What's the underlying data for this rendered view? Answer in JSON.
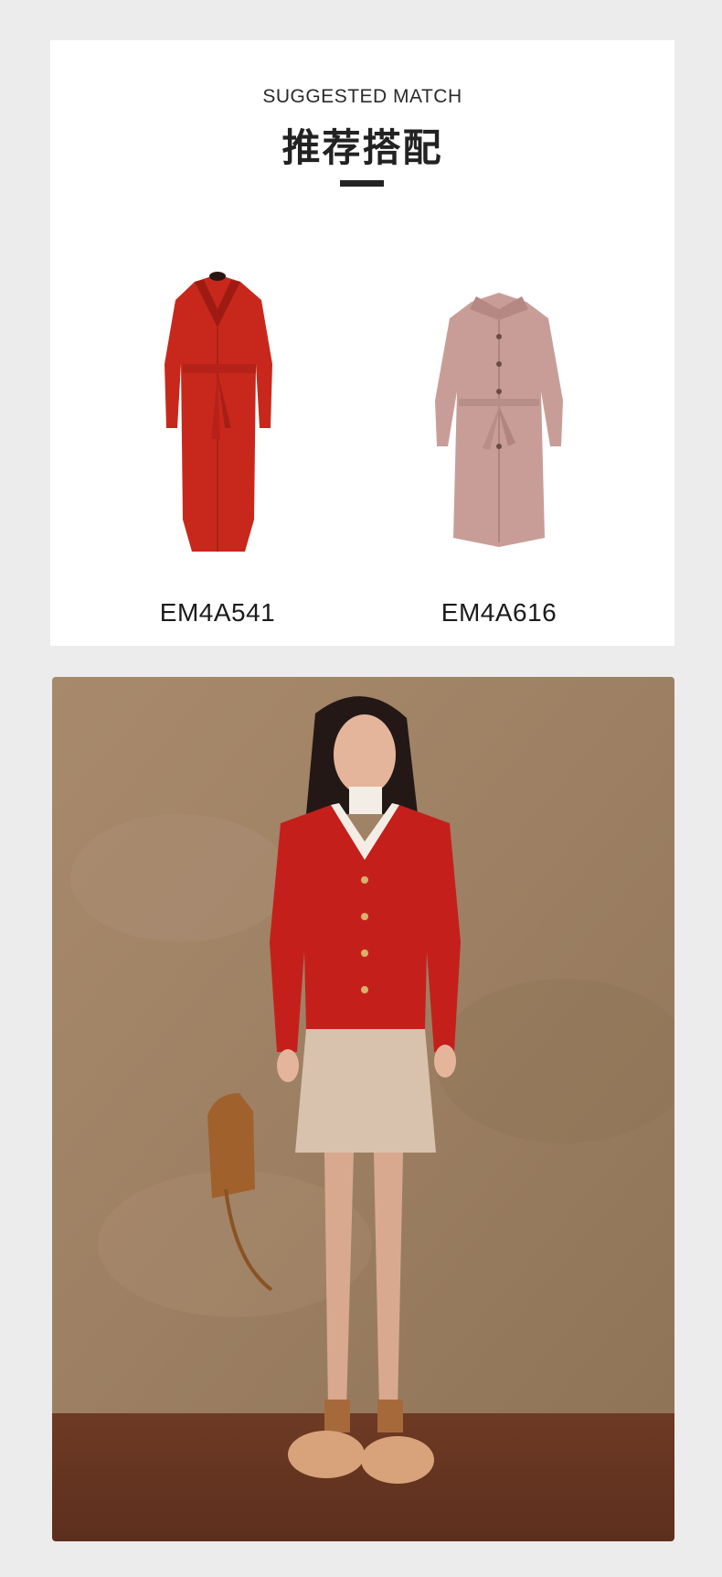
{
  "section": {
    "eyebrow": "SUGGESTED MATCH",
    "title": "推荐搭配"
  },
  "products": [
    {
      "code": "EM4A541",
      "color": "#c8281c"
    },
    {
      "code": "EM4A616",
      "color": "#c89d98"
    }
  ],
  "colors": {
    "page_bg": "#ececec",
    "card_bg": "#ffffff",
    "rule": "#222222"
  }
}
